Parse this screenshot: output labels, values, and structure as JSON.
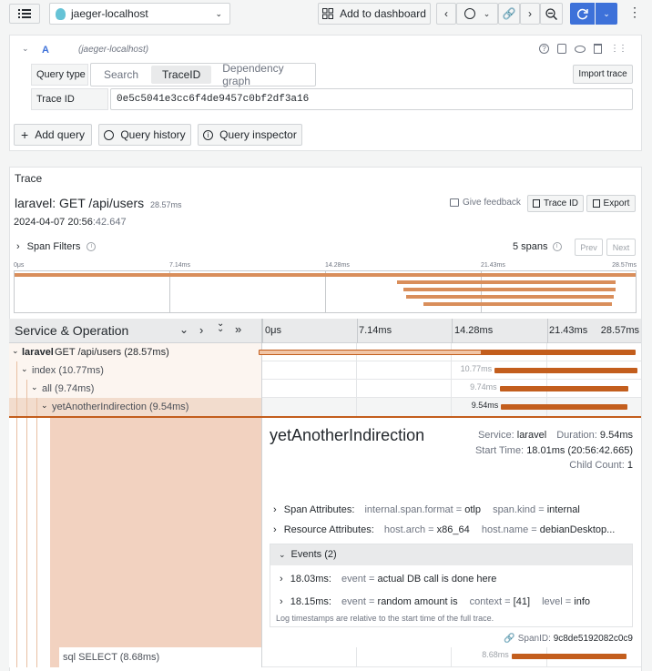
{
  "toolbar": {
    "datasource": "jaeger-localhost",
    "add_to_dashboard": "Add to dashboard"
  },
  "query": {
    "ref": "A",
    "datasource_note": "(jaeger-localhost)",
    "type_label": "Query type",
    "types": [
      "Search",
      "TraceID",
      "Dependency graph"
    ],
    "active_type": "TraceID",
    "import_trace": "Import trace",
    "trace_id_label": "Trace ID",
    "trace_id_value": "0e5c5041e3cc6f4de9457c0bf2df3a16",
    "add_query": "Add query",
    "query_history": "Query history",
    "query_inspector": "Query inspector"
  },
  "trace": {
    "panel_title": "Trace",
    "title": "laravel: GET /api/users",
    "duration": "28.57ms",
    "date": "2024-04-07 20:56",
    "date_seconds": ":42.647",
    "give_feedback": "Give feedback",
    "trace_id_btn": "Trace ID",
    "export_btn": "Export",
    "span_filters": "Span Filters",
    "span_count": "5 spans",
    "prev": "Prev",
    "next": "Next",
    "minimap_ticks": [
      "0μs",
      "7.14ms",
      "14.28ms",
      "21.43ms",
      "28.57ms"
    ],
    "header_label": "Service & Operation",
    "ticks": [
      "0μs",
      "7.14ms",
      "14.28ms",
      "21.43ms",
      "28.57ms"
    ]
  },
  "spans": [
    {
      "service": "laravel",
      "op": "GET /api/users (28.57ms)",
      "dur_label": "",
      "start": 0,
      "duration": 28.57
    },
    {
      "service": "",
      "op": "index (10.77ms)",
      "dur_label": "10.77ms",
      "start": 17.6,
      "duration": 10.77
    },
    {
      "service": "",
      "op": "all (9.74ms)",
      "dur_label": "9.74ms",
      "start": 17.9,
      "duration": 9.74
    },
    {
      "service": "",
      "op": "yetAnotherIndirection (9.54ms)",
      "dur_label": "9.54ms",
      "start": 18.01,
      "duration": 9.54
    },
    {
      "service": "",
      "op": "sql SELECT (8.68ms)",
      "dur_label": "8.68ms",
      "start": 18.8,
      "duration": 8.68
    }
  ],
  "detail": {
    "name": "yetAnotherIndirection",
    "service_label": "Service:",
    "service": "laravel",
    "duration_label": "Duration:",
    "duration": "9.54ms",
    "start_label": "Start Time:",
    "start": "18.01ms (20:56:42.665)",
    "child_label": "Child Count:",
    "child": "1",
    "span_attr_label": "Span Attributes:",
    "span_attrs": [
      {
        "k": "internal.span.format",
        "v": "otlp"
      },
      {
        "k": "span.kind",
        "v": "internal"
      }
    ],
    "res_attr_label": "Resource Attributes:",
    "res_attrs": [
      {
        "k": "host.arch",
        "v": "x86_64"
      },
      {
        "k": "host.name",
        "v": "debianDesktop..."
      }
    ],
    "events_label": "Events (2)",
    "events": [
      {
        "time": "18.03ms:",
        "k": "event",
        "v": "actual DB call is done here"
      },
      {
        "time": "18.15ms:",
        "k": "event",
        "v": "random amount is",
        "k2": "context",
        "v2": "[41]",
        "k3": "level",
        "v3": "info"
      }
    ],
    "log_note": "Log timestamps are relative to the start time of the full trace.",
    "spanid_label": "SpanID:",
    "spanid": "9c8de5192082c0c9"
  }
}
